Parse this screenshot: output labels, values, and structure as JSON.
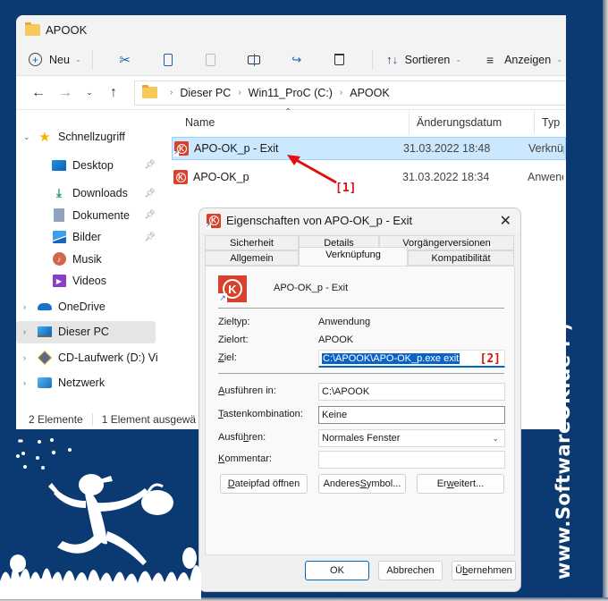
{
  "explorer": {
    "title": "APOOK",
    "toolbar": {
      "new_label": "Neu",
      "sort_label": "Sortieren",
      "view_label": "Anzeigen",
      "icons": [
        "cut-icon",
        "copy-icon",
        "paste-icon",
        "rename-icon",
        "share-icon",
        "delete-icon"
      ]
    },
    "breadcrumb": [
      "Dieser PC",
      "Win11_ProC (C:)",
      "APOOK"
    ],
    "sidebar": {
      "quick_access": "Schnellzugriff",
      "quick_items": [
        {
          "label": "Desktop",
          "pinned": true
        },
        {
          "label": "Downloads",
          "pinned": true
        },
        {
          "label": "Dokumente",
          "pinned": true
        },
        {
          "label": "Bilder",
          "pinned": true
        },
        {
          "label": "Musik",
          "pinned": false
        },
        {
          "label": "Videos",
          "pinned": false
        }
      ],
      "roots": [
        {
          "label": "OneDrive"
        },
        {
          "label": "Dieser PC",
          "selected": true
        },
        {
          "label": "CD-Laufwerk (D:) Vi"
        },
        {
          "label": "Netzwerk"
        }
      ]
    },
    "columns": {
      "name": "Name",
      "date": "Änderungsdatum",
      "type": "Typ"
    },
    "files": [
      {
        "name": "APO-OK_p - Exit",
        "date": "31.03.2022 18:48",
        "type": "Verknüpfung",
        "selected": true,
        "shortcut": true
      },
      {
        "name": "APO-OK_p",
        "date": "31.03.2022 18:34",
        "type": "Anwendung",
        "selected": false,
        "shortcut": false
      }
    ],
    "status": {
      "count": "2 Elemente",
      "selection": "1 Element ausgewä"
    }
  },
  "annotations": {
    "one": "[1]",
    "two": "[2]",
    "color": "#e01010"
  },
  "dialog": {
    "title": "Eigenschaften von APO-OK_p - Exit",
    "tabs_row1": [
      "Sicherheit",
      "Details",
      "Vorgängerversionen"
    ],
    "tabs_row2": [
      "Allgemein",
      "Verknüpfung",
      "Kompatibilität"
    ],
    "active_tab": "Verknüpfung",
    "shortcut_name": "APO-OK_p - Exit",
    "target_type_label": "Zieltyp:",
    "target_type": "Anwendung",
    "target_location_label": "Zielort:",
    "target_location": "APOOK",
    "target_label_u": "Z",
    "target_label_rest": "iel:",
    "target_value": "C:\\APOOK\\APO-OK_p.exe exit",
    "start_in_u": "A",
    "start_in_rest": "usführen in:",
    "start_in_value": "C:\\APOOK",
    "hotkey_u": "T",
    "hotkey_rest": "astenkombination:",
    "hotkey_value": "Keine",
    "run_pre": "Ausfü",
    "run_u": "h",
    "run_post": "ren:",
    "run_value": "Normales Fenster",
    "comment_u": "K",
    "comment_rest": "ommentar:",
    "comment_value": "",
    "btn_open_u": "D",
    "btn_open_rest": "ateipfad öffnen",
    "btn_icon_pre": "Anderes ",
    "btn_icon_u": "S",
    "btn_icon_post": "ymbol...",
    "btn_adv_pre": "Er",
    "btn_adv_u": "w",
    "btn_adv_post": "eitert...",
    "ok": "OK",
    "cancel": "Abbrechen",
    "apply_pre": "Ü",
    "apply_u": "b",
    "apply_post": "ernehmen",
    "accent": "#0067c0"
  },
  "watermark": "www.SoftwareOK.de :-)",
  "background_color": "#0b3a73"
}
